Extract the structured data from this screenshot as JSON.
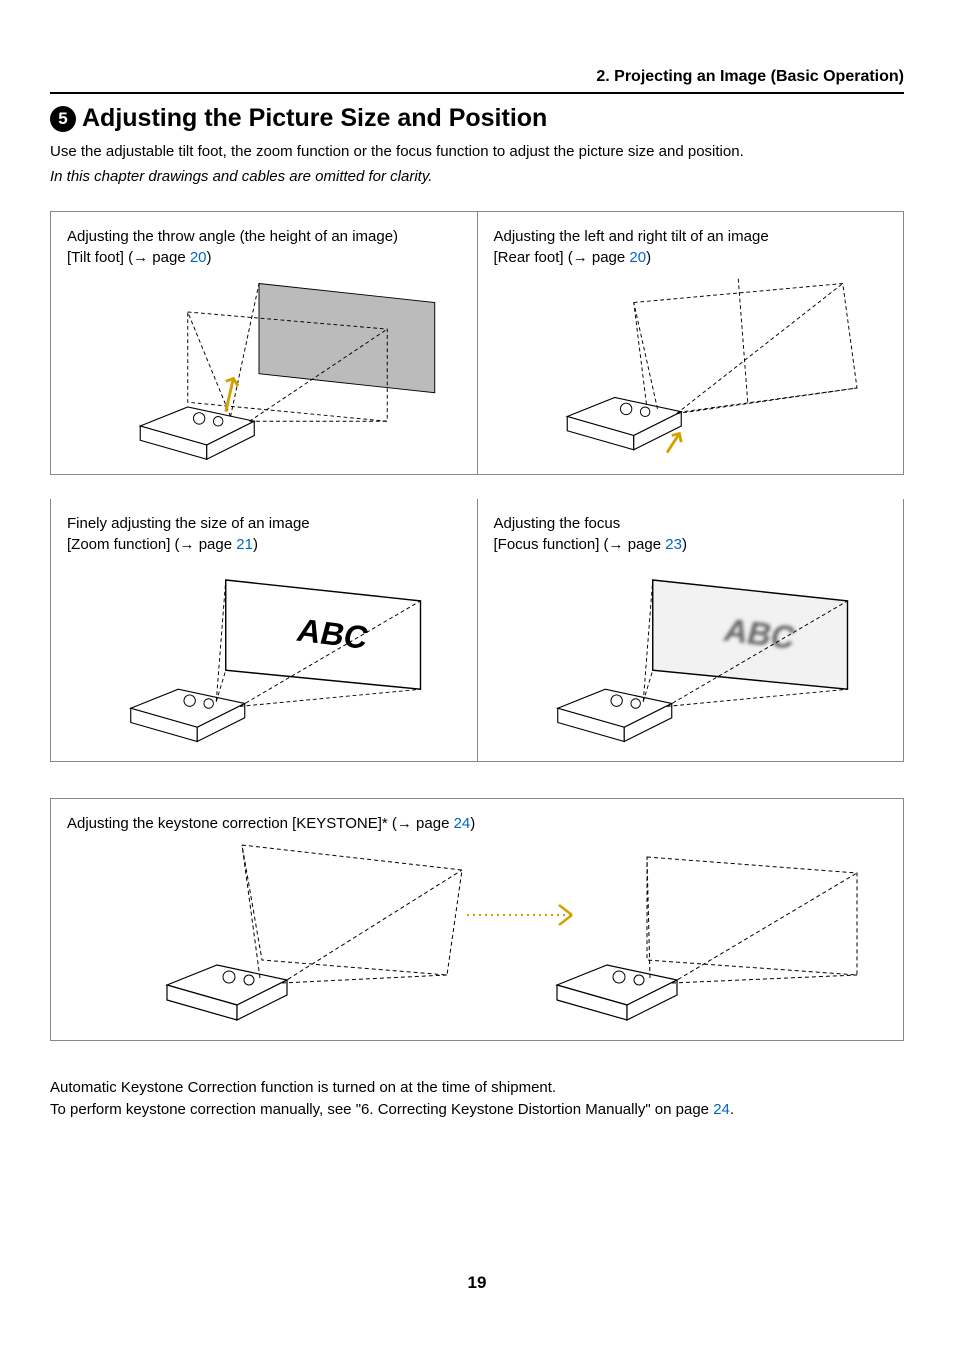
{
  "chapter_header": "2. Projecting an Image (Basic Operation)",
  "section": {
    "number": "5",
    "title": "Adjusting the Picture Size and Position"
  },
  "intro": {
    "line1": "Use the adjustable tilt foot, the zoom function or the focus function to adjust the picture size and position.",
    "line2": "In this chapter drawings and cables are omitted for clarity."
  },
  "cells": {
    "tilt_foot": {
      "text": "Adjusting the throw angle (the height of an image)",
      "sub_before": "[Tilt foot] (→ page ",
      "page": "20",
      "sub_after": ")"
    },
    "rear_foot": {
      "text": "Adjusting the left and right tilt of an image",
      "sub_before": "[Rear foot] (→ page ",
      "page": "20",
      "sub_after": ")"
    },
    "zoom": {
      "text": "Finely adjusting the size of an image",
      "sub_before": "[Zoom function] (→ page ",
      "page": "21",
      "sub_after": ")"
    },
    "focus": {
      "text": "Adjusting the focus",
      "sub_before": "[Focus function] (→ page ",
      "page": "23",
      "sub_after": ")"
    },
    "keystone": {
      "text_before": "Adjusting the keystone correction [KEYSTONE]* (→ page ",
      "page": "24",
      "text_after": ")"
    }
  },
  "after": {
    "line1": "Automatic Keystone Correction function is turned on at the time of shipment.",
    "line2_before": "To perform keystone correction manually, see \"6. Correcting Keystone Distortion Manually\" on page ",
    "page": "24",
    "line2_after": "."
  },
  "page_number": "19"
}
